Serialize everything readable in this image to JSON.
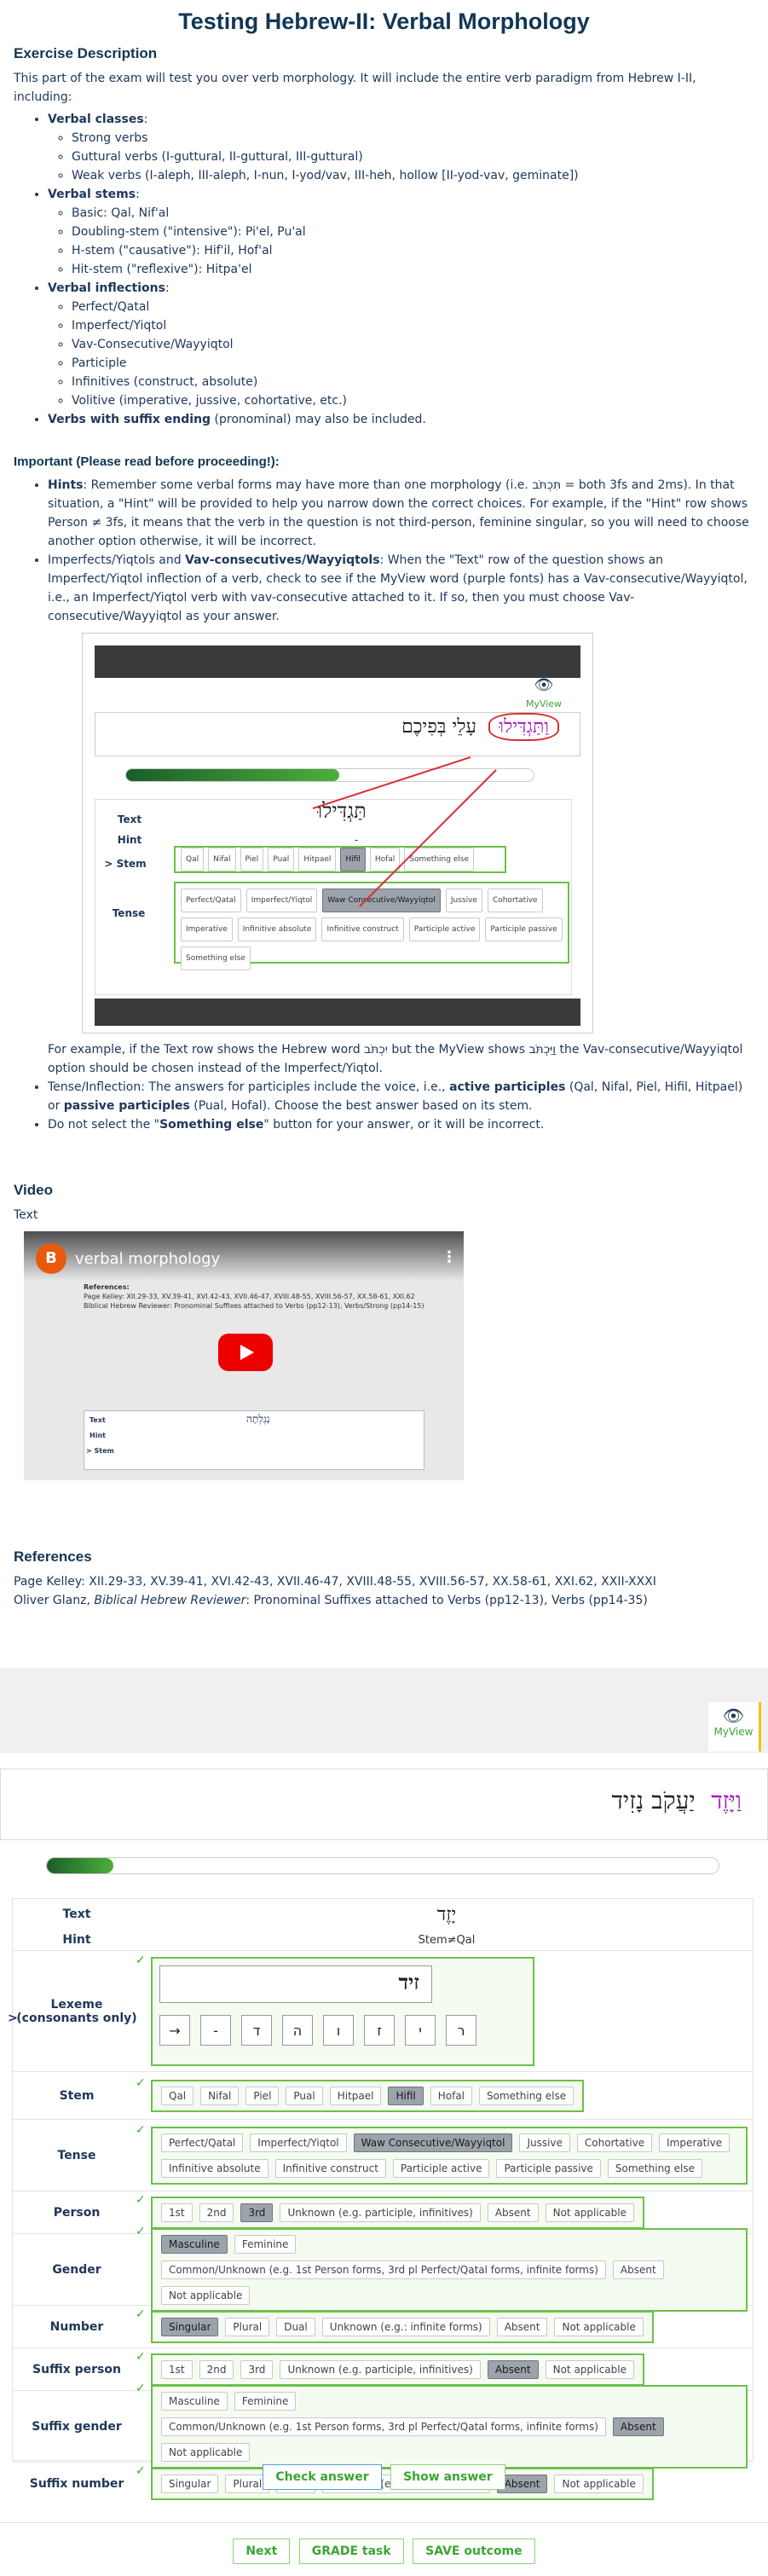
{
  "title": "Testing Hebrew-II: Verbal Morphology",
  "desc": {
    "heading": "Exercise Description",
    "intro": "This part of the exam will test you over verb morphology. It will include the entire verb paradigm from Hebrew I-II, including:",
    "classes_label": "Verbal classes",
    "classes": [
      "Strong verbs",
      "Guttural verbs (I-guttural, II-guttural, III-guttural)",
      "Weak verbs (I-aleph, III-aleph, I-nun, I-yod/vav, III-heh, hollow [II-yod-vav, geminate])"
    ],
    "stems_label": "Verbal stems",
    "stems": [
      "Basic: Qal, Nif'al",
      "Doubling-stem (\"intensive\"): Pi'el, Pu'al",
      "H-stem (\"causative\"): Hif'il, Hof'al",
      "Hit-stem (\"reflexive\"): Hitpa'el"
    ],
    "infl_label": "Verbal inflections",
    "infl": [
      "Perfect/Qatal",
      "Imperfect/Yiqtol",
      "Vav-Consecutive/Wayyiqtol",
      "Participle",
      "Infinitives (construct, absolute)",
      "Volitive (imperative, jussive, cohortative, etc.)"
    ],
    "suffix_label": "Verbs with suffix ending",
    "suffix_rest": "(pronominal) may also be included."
  },
  "important": {
    "heading": "Important (Please read before proceeding!):",
    "hints_label": "Hints",
    "hints_text": ": Remember some verbal forms may have more than one morphology (i.e. תִּכְתֹּב = both 3fs and 2ms). In that situation, a \"Hint\" will be provided to help you narrow down the correct choices. For example, if the \"Hint\" row shows Person ≠ 3fs, it means that the verb in the question is not third-person, feminine singular, so you will need to choose another option otherwise, it will be incorrect.",
    "imperf_a": "Imperfects/Yiqtols and ",
    "imperf_label": "Vav-consecutives/Wayyiqtols",
    "imperf_text": ": When the \"Text\" row of the question shows an Imperfect/Yiqtol inflection of a verb, check to see if the MyView word (purple fonts) has a Vav-consecutive/Wayyiqtol, i.e., an Imperfect/Yiqtol verb with vav-consecutive attached to it. If so, then you must choose Vav-consecutive/Wayyiqtol as your answer.",
    "example": "For example, if the Text row shows the Hebrew word יִכְתֹּב but the MyView shows וַיִּכְתֹּב the Vav-consecutive/Wayyiqtol option should be chosen instead of the Imperfect/Yiqtol.",
    "tense_a": "Tense/Inflection: The answers for participles include the voice, i.e., ",
    "tense_b": "active participles",
    "tense_c": " (Qal, Nifal, Piel, Hifil, Hitpael) or ",
    "tense_d": "passive participles",
    "tense_e": " (Pual, Hofal). Choose the best answer based on its stem.",
    "dont_a": "Do not select the \"",
    "dont_b": "Something else",
    "dont_c": "\" button for your answer, or it will be incorrect."
  },
  "shot": {
    "myview": "MyView",
    "sentence_rest": "עָלֵי בְּפִיכֶם",
    "sentence_purple": "וַתַּגְדִּילוּ",
    "text_label": "Text",
    "hint_label": "Hint",
    "stem_label": "Stem",
    "tense_label": "Tense",
    "text_word": "תַּגְדִּילוּ",
    "hint_value": "-",
    "stems": [
      "Qal",
      "Nifal",
      "Piel",
      "Pual",
      "Hitpael",
      "Hifil",
      "Hofal",
      "Something else"
    ],
    "tenses": [
      "Perfect/Qatal",
      "Imperfect/Yiqtol",
      "Waw Consecutive/Wayyiqtol",
      "Jussive",
      "Cohortative",
      "Imperative",
      "Infinitive absolute",
      "Infinitive construct",
      "Participle active",
      "Participle passive",
      "Something else"
    ]
  },
  "video": {
    "heading": "Video",
    "text": "Text",
    "avatar": "B",
    "title": "verbal morphology",
    "references": "References:",
    "ref1": "Page Kelley: XII.29-33, XV.39-41, XVI.42-43, XVII.46-47, XVIII.48-55, XVIII.56-57, XX.58-61, XXI.62",
    "ref2": "Biblical Hebrew Reviewer: Pronominal Suffixes attached to Verbs (pp12-13), Verbs/Strong (pp14-15)",
    "hint": "Hint",
    "stem": "Stem",
    "word": "נִגְלְתָה"
  },
  "refs": {
    "heading": "References",
    "line1": "Page Kelley: XII.29-33, XV.39-41, XVI.42-43, XVII.46-47, XVIII.48-55, XVIII.56-57, XX.58-61, XXI.62, XXII-XXXI",
    "line2_a": "Oliver Glanz, ",
    "line2_b": "Biblical Hebrew Reviewer",
    "line2_c": ": Pronominal Suffixes attached to Verbs (pp12-13), Verbs (pp14-35)"
  },
  "exercise": {
    "myview": "MyView",
    "sentence_purple": "וַיָּזֶד",
    "sentence_rest": "יַעֲקֹב נָזִיד",
    "text_label": "Text",
    "text_value": "יָזֶד",
    "hint_label": "Hint",
    "hint_value": "Stem≠Qal",
    "lexeme_label": "Lexeme (consonants only)",
    "lexeme_value": "זיד",
    "keys": [
      "→",
      "-",
      "ד",
      "ה",
      "ו",
      "ז",
      "י",
      "ר"
    ],
    "rows": [
      {
        "label": "Stem",
        "options": [
          "Qal",
          "Nifal",
          "Piel",
          "Pual",
          "Hitpael",
          "Hifil",
          "Hofal",
          "Something else"
        ],
        "selected": [
          "Hifil"
        ]
      },
      {
        "label": "Tense",
        "options": [
          "Perfect/Qatal",
          "Imperfect/Yiqtol",
          "Waw Consecutive/Wayyiqtol",
          "Jussive",
          "Cohortative",
          "Imperative",
          "Infinitive absolute",
          "Infinitive construct",
          "Participle active",
          "Participle passive",
          "Something else"
        ],
        "selected": [
          "Waw Consecutive/Wayyiqtol"
        ]
      },
      {
        "label": "Person",
        "options": [
          "1st",
          "2nd",
          "3rd",
          "Unknown (e.g. participle, infinitives)",
          "Absent",
          "Not applicable"
        ],
        "selected": [
          "3rd"
        ]
      },
      {
        "label": "Gender",
        "options": [
          "Masculine",
          "Feminine",
          "Common/Unknown (e.g. 1st Person forms, 3rd pl Perfect/Qatal forms, infinite forms)",
          "Absent",
          "Not applicable"
        ],
        "selected": [
          "Masculine"
        ]
      },
      {
        "label": "Number",
        "options": [
          "Singular",
          "Plural",
          "Dual",
          "Unknown (e.g.: infinite forms)",
          "Absent",
          "Not applicable"
        ],
        "selected": [
          "Singular"
        ]
      },
      {
        "label": "Suffix person",
        "options": [
          "1st",
          "2nd",
          "3rd",
          "Unknown (e.g. participle, infinitives)",
          "Absent",
          "Not applicable"
        ],
        "selected": [
          "Absent"
        ]
      },
      {
        "label": "Suffix gender",
        "options": [
          "Masculine",
          "Feminine",
          "Common/Unknown (e.g. 1st Person forms, 3rd pl Perfect/Qatal forms, infinite forms)",
          "Absent",
          "Not applicable"
        ],
        "selected": [
          "Absent"
        ]
      },
      {
        "label": "Suffix number",
        "options": [
          "Singular",
          "Plural",
          "Dual",
          "Unknown (e.g.: infinite forms)",
          "Absent",
          "Not applicable"
        ],
        "selected": [
          "Absent"
        ]
      }
    ],
    "check_answer": "Check answer",
    "show_answer": "Show answer",
    "next": "Next",
    "grade": "GRADE task",
    "save": "SAVE outcome"
  },
  "colors": {
    "green": "#6cc04a",
    "purple": "#a020c8",
    "red": "#d93030"
  }
}
